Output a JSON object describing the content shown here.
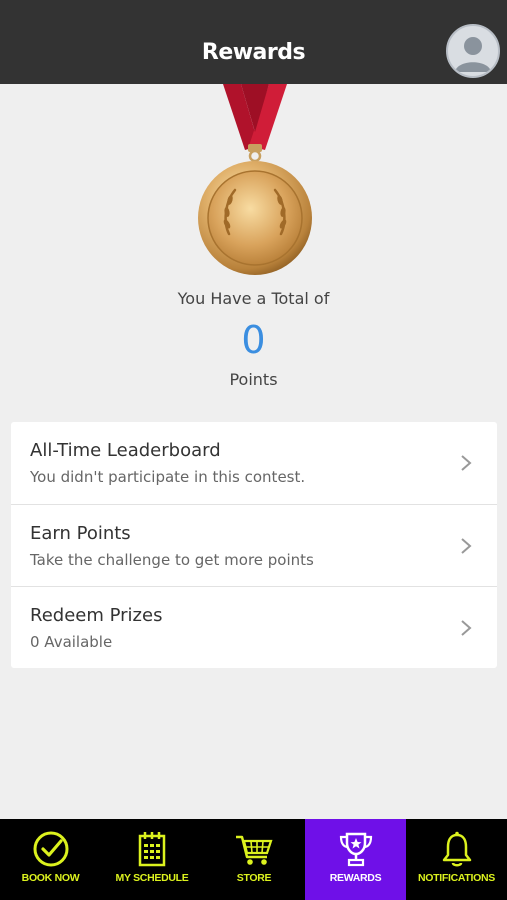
{
  "header": {
    "title": "Rewards"
  },
  "summary": {
    "total_label": "You Have a Total of",
    "points_value": "0",
    "points_label": "Points"
  },
  "menu": {
    "items": [
      {
        "title": "All-Time Leaderboard",
        "subtitle": "You didn't participate in this contest."
      },
      {
        "title": "Earn Points",
        "subtitle": "Take the challenge to get more points"
      },
      {
        "title": "Redeem Prizes",
        "subtitle": "0 Available"
      }
    ]
  },
  "tabbar": {
    "tabs": [
      {
        "label": "BOOK NOW",
        "icon": "check-circle-icon"
      },
      {
        "label": "MY SCHEDULE",
        "icon": "calendar-icon"
      },
      {
        "label": "STORE",
        "icon": "cart-icon"
      },
      {
        "label": "REWARDS",
        "icon": "trophy-icon",
        "active": true
      },
      {
        "label": "NOTIFICATIONS",
        "icon": "bell-icon"
      }
    ]
  },
  "colors": {
    "header_bg": "#333333",
    "accent_points": "#3b8ee0",
    "tab_active_bg": "#6f10e8",
    "tab_label": "#dcf21e"
  }
}
